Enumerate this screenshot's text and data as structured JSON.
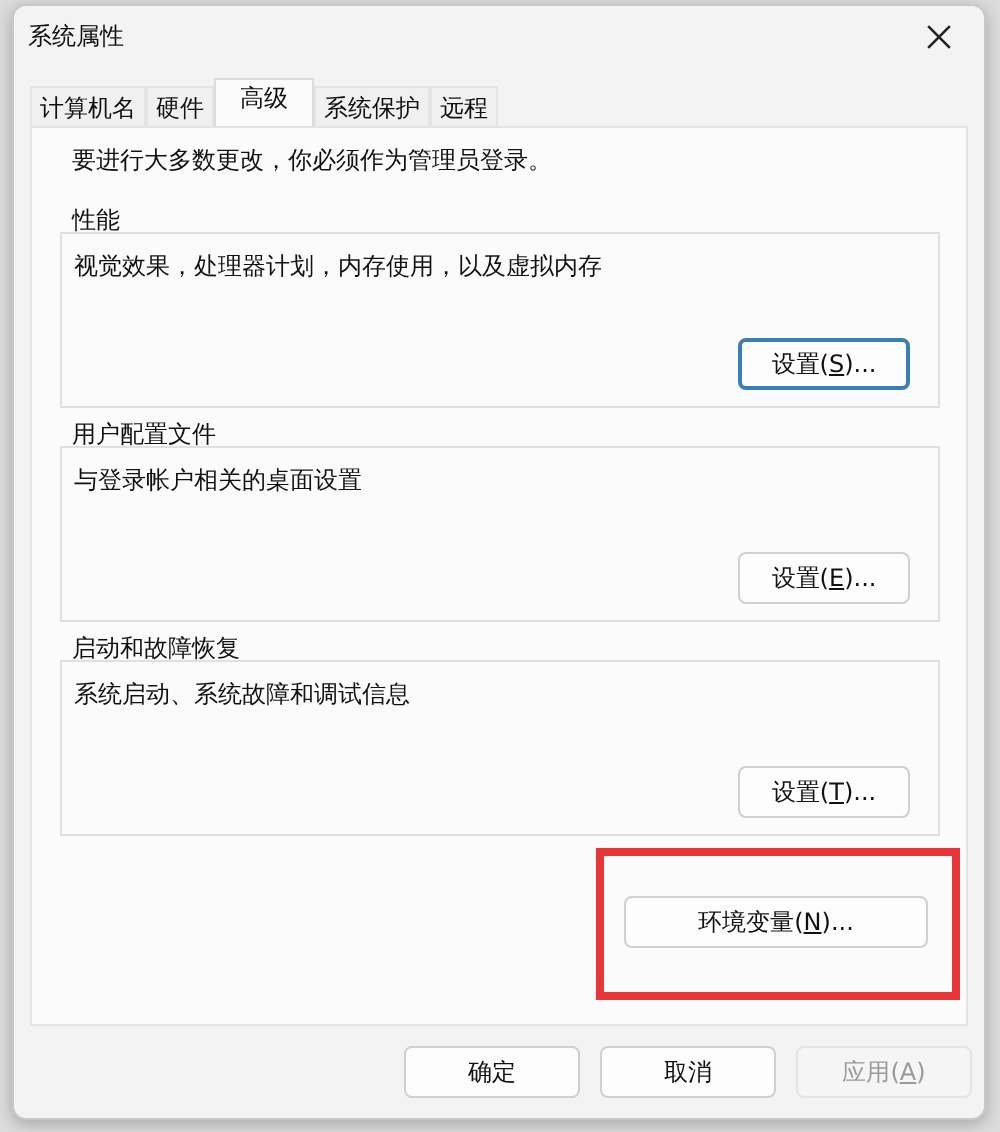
{
  "window": {
    "title": "系统属性"
  },
  "tabs": [
    {
      "label": "计算机名",
      "selected": false
    },
    {
      "label": "硬件",
      "selected": false
    },
    {
      "label": "高级",
      "selected": true
    },
    {
      "label": "系统保护",
      "selected": false
    },
    {
      "label": "远程",
      "selected": false
    }
  ],
  "notice": "要进行大多数更改，你必须作为管理员登录。",
  "groups": [
    {
      "title": "性能",
      "description": "视觉效果，处理器计划，内存使用，以及虚拟内存",
      "button": {
        "prefix": "设置(",
        "mnemonic": "S",
        "suffix": ")...",
        "focused": true
      }
    },
    {
      "title": "用户配置文件",
      "description": "与登录帐户相关的桌面设置",
      "button": {
        "prefix": "设置(",
        "mnemonic": "E",
        "suffix": ")...",
        "focused": false
      }
    },
    {
      "title": "启动和故障恢复",
      "description": "系统启动、系统故障和调试信息",
      "button": {
        "prefix": "设置(",
        "mnemonic": "T",
        "suffix": ")...",
        "focused": false
      }
    }
  ],
  "env_button": {
    "prefix": "环境变量(",
    "mnemonic": "N",
    "suffix": ")...",
    "highlighted": true
  },
  "footer_buttons": [
    {
      "prefix": "确定",
      "disabled": false
    },
    {
      "prefix": "取消",
      "disabled": false
    },
    {
      "prefix": "应用(",
      "mnemonic": "A",
      "suffix": ")",
      "disabled": true
    }
  ]
}
